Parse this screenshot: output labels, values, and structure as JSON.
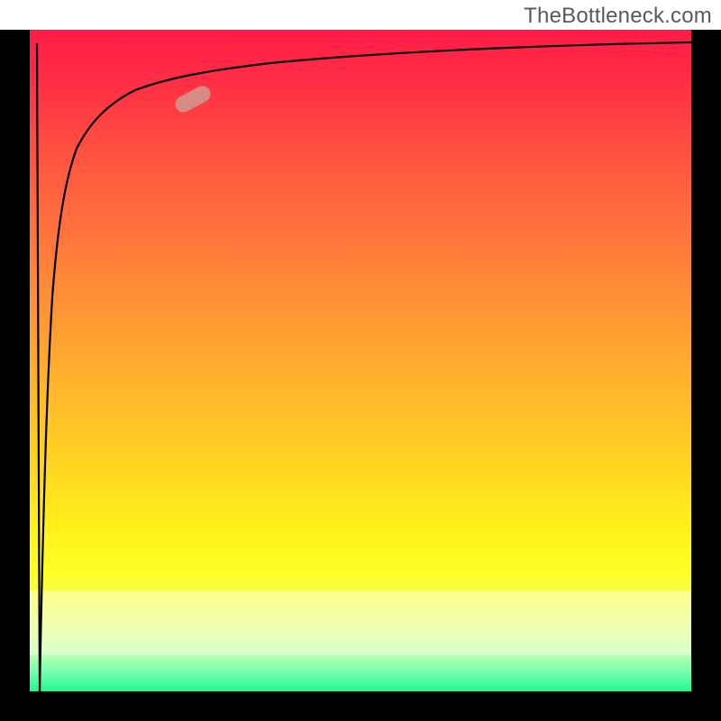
{
  "attribution": "TheBottleneck.com",
  "colors": {
    "gradient_top": "#ff1b47",
    "gradient_bottom": "#25f78f",
    "curve": "#000000",
    "marker": "#d88a84",
    "frame": "#000000"
  },
  "chart_data": {
    "type": "line",
    "title": "",
    "xlabel": "",
    "ylabel": "",
    "xlim": [
      0,
      100
    ],
    "ylim": [
      0,
      100
    ],
    "grid": false,
    "legend": false,
    "note": "No numeric axis ticks or labels are rendered in the image; values below are read off pixel position and normalised to 0–100 on each axis.",
    "series": [
      {
        "name": "bottleneck-curve",
        "comment": "Steep rise from the x-axis near x≈2 up to ~y≈95, then a slow asymptotic climb toward y≈100 across the rest of the x range.",
        "x": [
          1.5,
          2.0,
          2.5,
          3.0,
          3.5,
          4.0,
          5.0,
          6.0,
          8.0,
          10,
          13,
          16,
          20,
          25,
          30,
          40,
          50,
          60,
          70,
          80,
          90,
          100
        ],
        "y": [
          0,
          25,
          45,
          58,
          66,
          72,
          78,
          82,
          86,
          88,
          90,
          91,
          92,
          93,
          93.8,
          95,
          95.8,
          96.4,
          96.9,
          97.3,
          97.6,
          97.9
        ]
      },
      {
        "name": "initial-drop",
        "comment": "Short near-vertical segment from the top-left interior down to the x-axis before the main curve begins.",
        "x": [
          1.0,
          1.5
        ],
        "y": [
          97.5,
          0
        ]
      }
    ],
    "annotations": [
      {
        "name": "highlight-marker",
        "shape": "pill",
        "approx_x": 24,
        "approx_y": 89,
        "angle_deg": -28
      }
    ]
  }
}
